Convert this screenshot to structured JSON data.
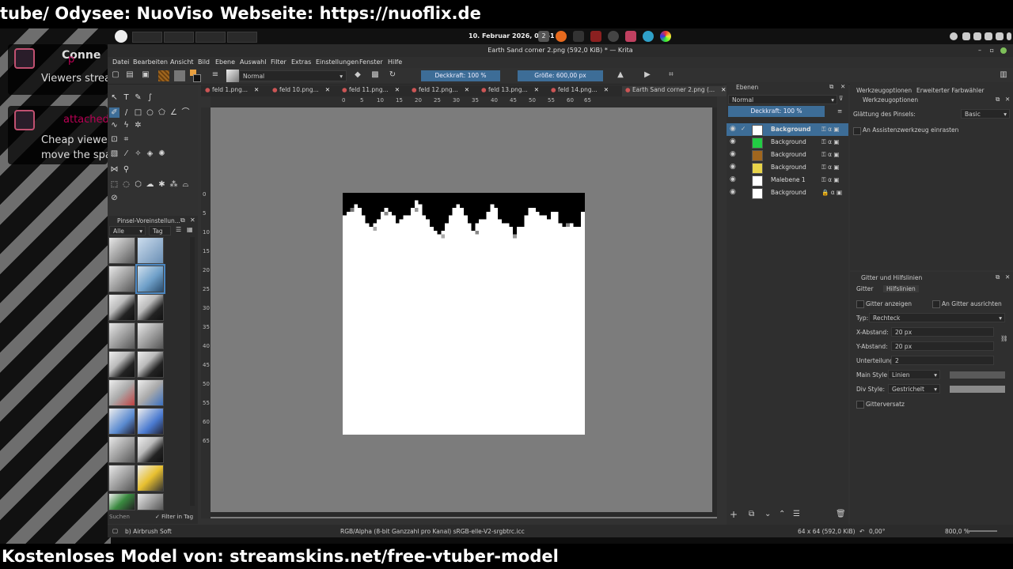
{
  "overlay": {
    "top_left": "tube/ Odysee: NuoViso",
    "top_right": "Webseite: https://nuoflix.de",
    "bottom": "Kostenloses Model von: streamskins.net/free-vtuber-model",
    "card1_title": "Conne",
    "card1_badge": "p",
    "card1_text": "Viewers strea",
    "card2_badge": "attached",
    "card2_text1": "Cheap viewer",
    "card2_text2": "move the spa"
  },
  "taskbar": {
    "clock": "10. Februar 2026, 04:51",
    "badge": "2"
  },
  "window": {
    "title": "Earth Sand corner 2.png (592,0 KiB) * — Krita"
  },
  "menu": [
    "Datei",
    "Bearbeiten",
    "Ansicht",
    "Bild",
    "Ebene",
    "Auswahl",
    "Filter",
    "Extras",
    "Einstellungen",
    "Fenster",
    "Hilfe"
  ],
  "toolbar": {
    "blend_mode": "Normal",
    "opacity": "Deckkraft: 100 %",
    "size": "Größe: 600,00 px"
  },
  "tabs": [
    "feld 1.png...",
    "feld 10.png...",
    "feld 11.png...",
    "feld 12.png...",
    "feld 13.png...",
    "feld 14.png...",
    "Earth Sand corner 2.png (..."
  ],
  "ruler_h": [
    "0",
    "5",
    "10",
    "15",
    "20",
    "25",
    "30",
    "35",
    "40",
    "45",
    "50",
    "55",
    "60",
    "65"
  ],
  "ruler_v": [
    "0",
    "5",
    "10",
    "15",
    "20",
    "25",
    "30",
    "35",
    "40",
    "45",
    "50",
    "55",
    "60",
    "65"
  ],
  "brush_docker": {
    "title": "Pinsel-Voreinstellun...",
    "filter": "Alle",
    "tag": "Tag",
    "search": "Suchen",
    "filter_in_tag": "Filter in Tag"
  },
  "layers": {
    "title": "Ebenen",
    "blend": "Normal",
    "opacity": "Deckkraft: 100 %",
    "items": [
      {
        "name": "Background",
        "color": "#ffffff"
      },
      {
        "name": "Background",
        "color": "#22cc44"
      },
      {
        "name": "Background",
        "color": "#a0661e"
      },
      {
        "name": "Background",
        "color": "#e8d44a"
      },
      {
        "name": "Malebene 1",
        "color": "#ffffff"
      },
      {
        "name": "Background",
        "color": "#ffffff"
      }
    ]
  },
  "tool_options": {
    "tab1": "Werkzeugoptionen",
    "tab2": "Erweiterter Farbwähler",
    "header": "Werkzeugoptionen",
    "smoothing_label": "Glättung des Pinsels:",
    "smoothing_value": "Basic",
    "assistant": "An Assistenzwerkzeug einrasten"
  },
  "grid": {
    "title": "Gitter und Hilfslinien",
    "tab1": "Gitter",
    "tab2": "Hilfslinien",
    "show_grid": "Gitter anzeigen",
    "snap_grid": "An Gitter ausrichten",
    "type_label": "Typ:",
    "type_value": "Rechteck",
    "x_label": "X-Abstand:",
    "x_value": "20 px",
    "y_label": "Y-Abstand:",
    "y_value": "20 px",
    "sub_label": "Unterteilung:",
    "sub_value": "2",
    "main_style_label": "Main Style:",
    "main_style_value": "Linien",
    "div_style_label": "Div Style:",
    "div_style_value": "Gestrichelt",
    "offset": "Gitterversatz"
  },
  "status": {
    "brush": "b) Airbrush Soft",
    "color_info": "RGB/Alpha (8-bit Ganzzahl pro Kanal)  sRGB-elle-V2-srgbtrc.icc",
    "size": "64 x 64 (592,0 KiB)",
    "rotation": "0,00°",
    "zoom": "800,0 %"
  }
}
